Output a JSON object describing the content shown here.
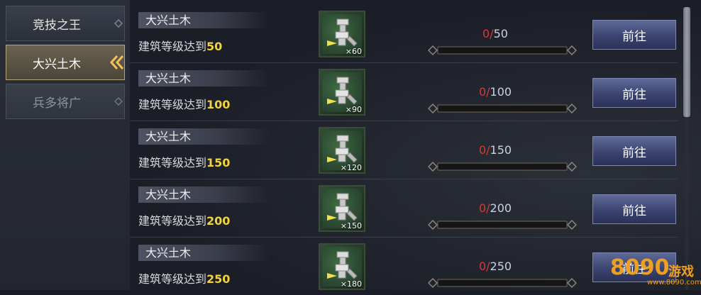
{
  "sidebar": {
    "tabs": [
      {
        "label": "竞技之王",
        "state": "normal"
      },
      {
        "label": "大兴土木",
        "state": "active"
      },
      {
        "label": "兵多将广",
        "state": "disabled"
      }
    ]
  },
  "tasks": [
    {
      "title": "大兴土木",
      "condition_prefix": "建筑等级达到",
      "requirement": "50",
      "reward_qty": "×60",
      "progress_current": "0",
      "progress_sep": "/",
      "progress_target": "50",
      "progress_fraction": 0,
      "button": "前往"
    },
    {
      "title": "大兴土木",
      "condition_prefix": "建筑等级达到",
      "requirement": "100",
      "reward_qty": "×90",
      "progress_current": "0",
      "progress_sep": "/",
      "progress_target": "100",
      "progress_fraction": 0,
      "button": "前往"
    },
    {
      "title": "大兴土木",
      "condition_prefix": "建筑等级达到",
      "requirement": "150",
      "reward_qty": "×120",
      "progress_current": "0",
      "progress_sep": "/",
      "progress_target": "150",
      "progress_fraction": 0,
      "button": "前往"
    },
    {
      "title": "大兴土木",
      "condition_prefix": "建筑等级达到",
      "requirement": "200",
      "reward_qty": "×150",
      "progress_current": "0",
      "progress_sep": "/",
      "progress_target": "200",
      "progress_fraction": 0,
      "button": "前往"
    },
    {
      "title": "大兴土木",
      "condition_prefix": "建筑等级达到",
      "requirement": "250",
      "reward_qty": "×180",
      "progress_current": "0",
      "progress_sep": "/",
      "progress_target": "250",
      "progress_fraction": 0,
      "button": "前往"
    }
  ],
  "watermark": {
    "brand": "8090",
    "text": "游戏",
    "url": "www.8090.com"
  },
  "colors": {
    "accent_gold": "#f3d33a",
    "progress_red": "#d43a3a",
    "button_blue": "#3b4470"
  },
  "icons": {
    "reward": "building-hammer-icon",
    "tab_arrow": "double-chevron-left-icon"
  }
}
